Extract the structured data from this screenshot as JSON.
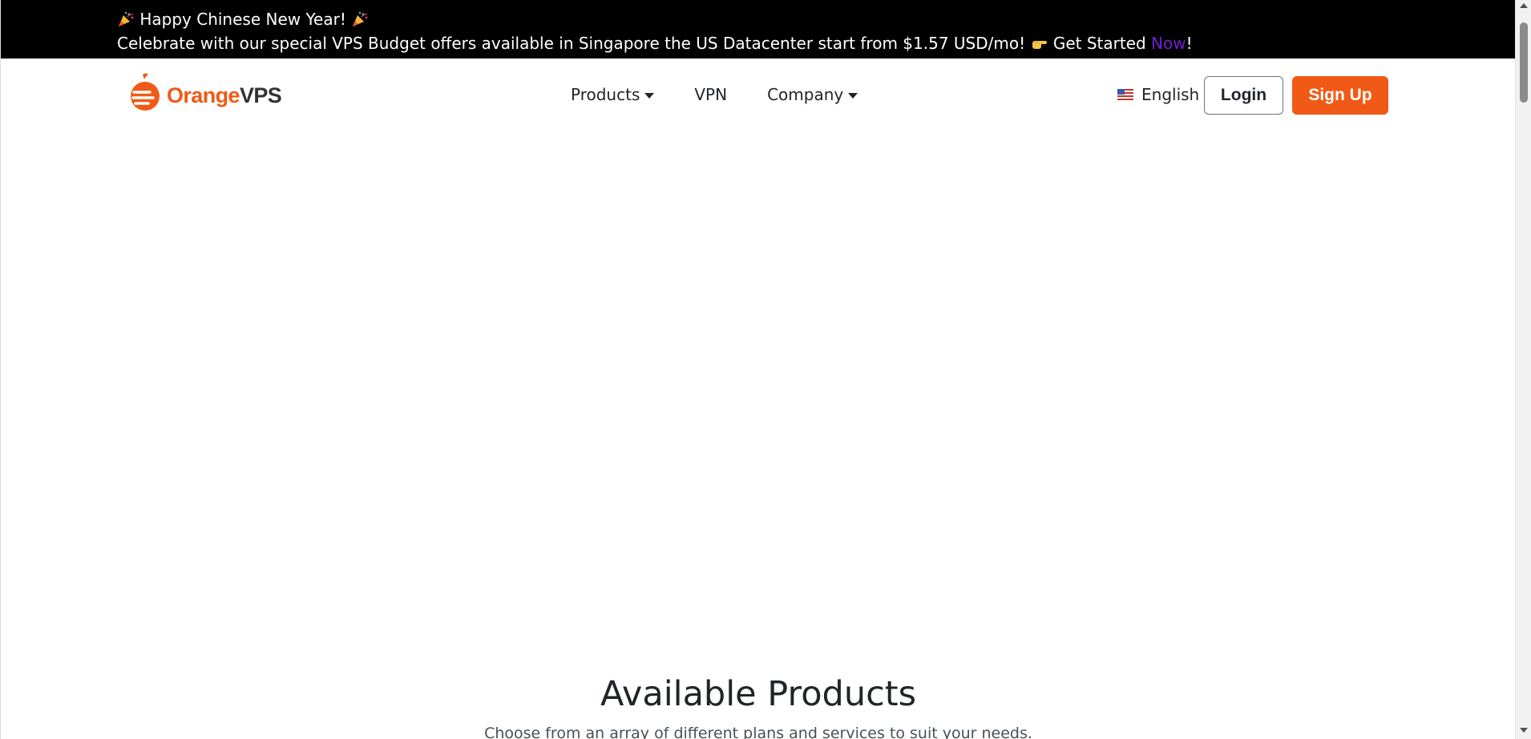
{
  "announcement": {
    "line1_pre_icon": "party-popper-icon",
    "line1_text": "Happy Chinese New Year!",
    "line1_post_icon": "party-popper-icon",
    "line2_text": "Celebrate with our special VPS Budget offers available in Singapore the US Datacenter start from $1.57 USD/mo!",
    "line2_icon": "pointing-hand-icon",
    "cta_text": "Get Started",
    "cta_link": "Now",
    "cta_suffix": "!",
    "link_color": "#6f1fd1"
  },
  "header": {
    "logo": {
      "part1": "Orange",
      "part2": "VPS",
      "brand_color": "#f05a16"
    },
    "nav": [
      {
        "label": "Products",
        "dropdown": true
      },
      {
        "label": "VPN",
        "dropdown": false
      },
      {
        "label": "Company",
        "dropdown": true
      }
    ],
    "language": {
      "label": "English",
      "icon": "us-flag-icon"
    },
    "login_label": "Login",
    "signup_label": "Sign Up",
    "signup_color": "#f05a16"
  },
  "products": {
    "title": "Available Products",
    "subtitle": "Choose from an array of different plans and services to suit your needs."
  }
}
